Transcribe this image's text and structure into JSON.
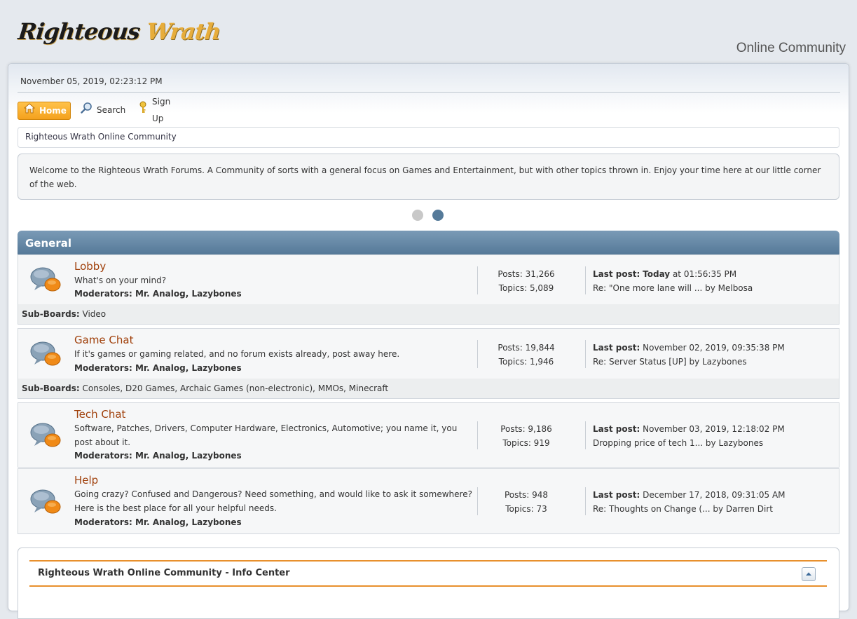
{
  "header": {
    "logo_word1": "Righteous",
    "logo_word2": "Wrath",
    "tagline": "Online Community"
  },
  "datetime": "November 05, 2019, 02:23:12 PM",
  "menu": {
    "home": "Home",
    "search": "Search",
    "signup": "Sign Up"
  },
  "breadcrumb": "Righteous Wrath Online Community",
  "welcome": "Welcome to the Righteous Wrath Forums.  A Community of sorts with a general focus on Games and Entertainment, but with other topics thrown in.  Enjoy your time here at our little corner of the web.",
  "category": "General",
  "labels": {
    "moderators": "Moderators:",
    "mods_names": "Mr. Analog, Lazybones",
    "last_post": "Last post:",
    "sub_boards": "Sub-Boards:"
  },
  "boards": [
    {
      "title": "Lobby",
      "desc": "What's on your mind?",
      "posts": "Posts: 31,266",
      "topics": "Topics: 5,089",
      "lp_when_bold": "Today",
      "lp_when": " at 01:56:35 PM",
      "lp_topic": "Re: \"One more lane will ... by Melbosa",
      "subboards": "Video"
    },
    {
      "title": "Game Chat",
      "desc": "If it's games or gaming related, and no forum exists already, post away here.",
      "posts": "Posts: 19,844",
      "topics": "Topics: 1,946",
      "lp_when": " November 02, 2019, 09:35:38 PM",
      "lp_topic": "Re: Server Status [UP] by Lazybones",
      "subboards": "Consoles, D20 Games, Archaic Games (non-electronic), MMOs, Minecraft"
    },
    {
      "title": "Tech Chat",
      "desc": "Software, Patches, Drivers, Computer Hardware, Electronics, Automotive; you name it, you post about it.",
      "posts": "Posts: 9,186",
      "topics": "Topics: 919",
      "lp_when": " November 03, 2019, 12:18:02 PM",
      "lp_topic": "Dropping price of tech 1... by Lazybones"
    },
    {
      "title": "Help",
      "desc": "Going crazy? Confused and Dangerous? Need something, and would like to ask it somewhere? Here is the best place for all your helpful needs.",
      "posts": "Posts: 948",
      "topics": "Topics: 73",
      "lp_when": " December 17, 2018, 09:31:05 AM",
      "lp_topic": "Re: Thoughts on Change (... by Darren Dirt"
    }
  ],
  "info_center": "Righteous Wrath Online Community - Info Center",
  "colors": {
    "accent_orange": "#f4a11d",
    "category_blue": "#557998",
    "board_title": "#a0400b"
  }
}
